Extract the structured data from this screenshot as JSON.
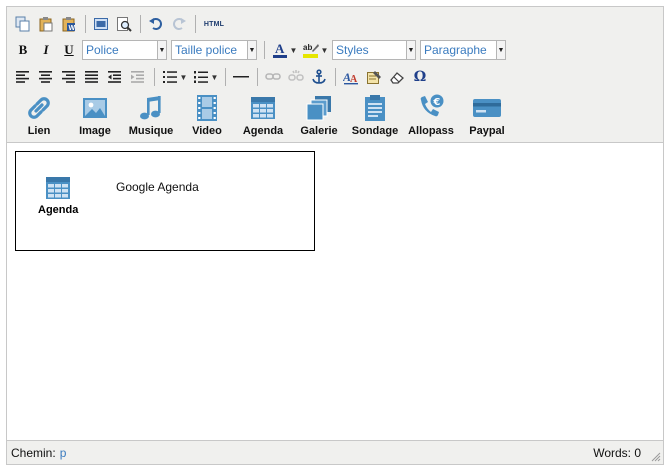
{
  "toolbar": {
    "html_label": "HTML",
    "font_select": {
      "value": "Police"
    },
    "size_select": {
      "value": "Taille police"
    },
    "styles_select": {
      "value": "Styles"
    },
    "format_select": {
      "value": "Paragraphe"
    },
    "bold_label": "B",
    "italic_label": "I",
    "underline_label": "U",
    "omega_label": "Ω",
    "textcolor_label": "A",
    "bgcolor_label": "ab"
  },
  "media_buttons": [
    {
      "label": "Lien",
      "icon": "link-icon"
    },
    {
      "label": "Image",
      "icon": "image-icon"
    },
    {
      "label": "Musique",
      "icon": "music-icon"
    },
    {
      "label": "Video",
      "icon": "video-icon"
    },
    {
      "label": "Agenda",
      "icon": "calendar-icon"
    },
    {
      "label": "Galerie",
      "icon": "gallery-icon"
    },
    {
      "label": "Sondage",
      "icon": "clipboard-icon"
    },
    {
      "label": "Allopass",
      "icon": "phone-euro-icon"
    },
    {
      "label": "Paypal",
      "icon": "credit-card-icon"
    }
  ],
  "content": {
    "widget": {
      "icon_label": "Agenda",
      "title": "Google Agenda"
    }
  },
  "status": {
    "path_label": "Chemin:",
    "path_value": "p",
    "words": "Words: 0"
  },
  "colors": {
    "accent": "#4a90c4",
    "link_text": "#3a7bbf"
  }
}
